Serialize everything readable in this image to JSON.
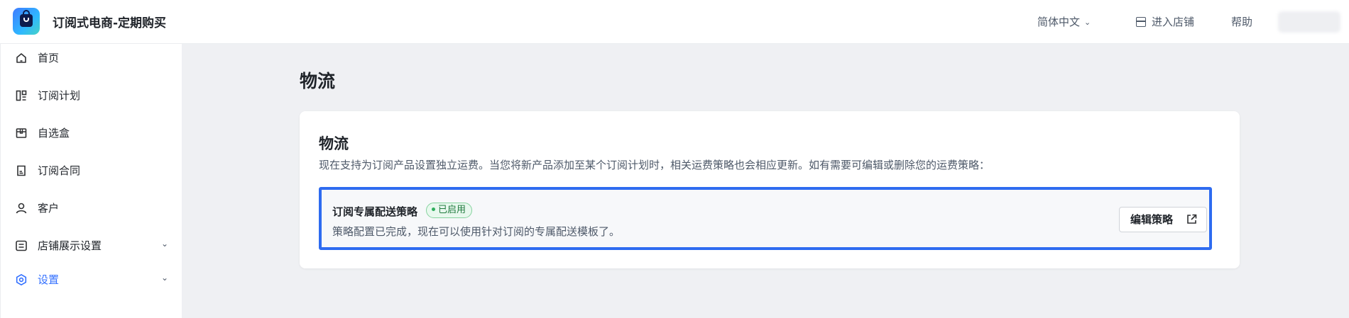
{
  "app": {
    "title": "订阅式电商-定期购买"
  },
  "header": {
    "language": "简体中文",
    "store_link": "进入店铺",
    "help": "帮助"
  },
  "sidebar": {
    "items": [
      {
        "label": "首页",
        "icon": "home-icon"
      },
      {
        "label": "订阅计划",
        "icon": "layout-icon"
      },
      {
        "label": "自选盒",
        "icon": "box-icon"
      },
      {
        "label": "订阅合同",
        "icon": "contract-icon"
      },
      {
        "label": "客户",
        "icon": "user-icon"
      },
      {
        "label": "店铺展示设置",
        "icon": "display-settings-icon",
        "expandable": true
      },
      {
        "label": "设置",
        "icon": "settings-icon",
        "expandable": true,
        "active": true
      }
    ]
  },
  "main": {
    "page_title": "物流",
    "card": {
      "title": "物流",
      "description": "现在支持为订阅产品设置独立运费。当您将新产品添加至某个订阅计划时，相关运费策略也会相应更新。如有需要可编辑或删除您的运费策略：",
      "policy": {
        "name": "订阅专属配送策略",
        "status": "已启用",
        "description": "策略配置已完成，现在可以使用针对订阅的专属配送模板了。",
        "edit_label": "编辑策略"
      }
    }
  },
  "colors": {
    "accent": "#3370ff",
    "highlight_border": "#2e6bf0",
    "status_green": "#2fae5d",
    "main_bg": "#eff0f3"
  }
}
